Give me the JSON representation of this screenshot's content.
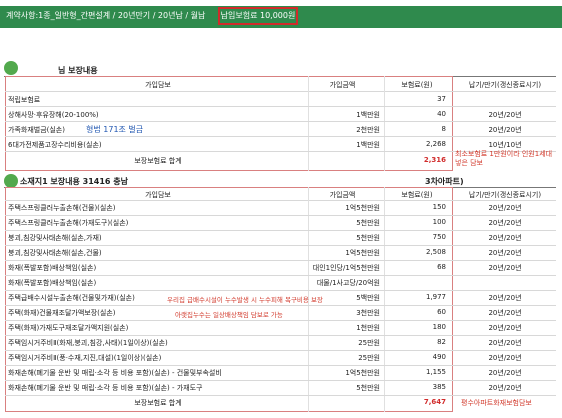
{
  "banner": {
    "text": "계약사항:1종_일반형_간편설계 / 20년만기 / 20년납 / 월납",
    "highlight": "납입보험료 10,000원"
  },
  "section1": {
    "title": "님 보장내용",
    "headers": [
      "가입담보",
      "가입금액",
      "보험료(원)",
      "납기/만기(갱신종료시기)"
    ],
    "rows": [
      {
        "name": "적립보험료",
        "amount": "",
        "premium": "37",
        "term": ""
      },
      {
        "name": "상해사망·후유장해(20-100%)",
        "amount": "1백만원",
        "premium": "40",
        "term": "20년/20년"
      },
      {
        "name": "가족화재벌금(실손)",
        "amount": "2천만원",
        "premium": "8",
        "term": "20년/20년"
      },
      {
        "name": "6대가전제품고장수리비용(실손)",
        "amount": "1백만원",
        "premium": "2,268",
        "term": "10년/10년"
      }
    ],
    "total_label": "보장보험료 합계",
    "total": "2,316",
    "note_blue": "형법 171조 벌금",
    "note_red": "최소보험료 1만원이라 인원1세대 넣은 담보"
  },
  "section2": {
    "title": "소재지1 보장내용 31416 충남",
    "subtitle": "3차아파트)",
    "headers": [
      "가입담보",
      "가입금액",
      "보험료(원)",
      "납기/만기(갱신종료시기)"
    ],
    "rows": [
      {
        "name": "주택스프링클러누출손해(건물)(실손)",
        "amount": "1억5천만원",
        "premium": "150",
        "term": "20년/20년"
      },
      {
        "name": "주택스프링클러누출손해(가재도구)(실손)",
        "amount": "5천만원",
        "premium": "100",
        "term": "20년/20년"
      },
      {
        "name": "붕괴,침강및사태손해(실손,가재)",
        "amount": "5천만원",
        "premium": "750",
        "term": "20년/20년"
      },
      {
        "name": "붕괴,침강및사태손해(실손,건물)",
        "amount": "1억5천만원",
        "premium": "2,508",
        "term": "20년/20년"
      },
      {
        "name": "화재(폭발포함)배상책임(실손)",
        "amount": "대인1인당/1억5천만원",
        "premium": "68",
        "term": "20년/20년"
      },
      {
        "name": "화재(폭발포함)배상책임(실손)",
        "amount": "대물/1사고당/20억원",
        "premium": "",
        "term": ""
      },
      {
        "name": "주택급배수시설누출손해(건물및가재)(실손)",
        "amount": "5백만원",
        "premium": "1,977",
        "term": "20년/20년"
      },
      {
        "name": "주택(화재)건물재조달가액보장(실손)",
        "amount": "3천만원",
        "premium": "60",
        "term": "20년/20년"
      },
      {
        "name": "주택(화재)가재도구재조달가액지원(실손)",
        "amount": "1천만원",
        "premium": "180",
        "term": "20년/20년"
      },
      {
        "name": "주택임시거주비Ⅱ(화재,붕괴,침강,사태)(1일이상)(실손)",
        "amount": "25만원",
        "premium": "82",
        "term": "20년/20년"
      },
      {
        "name": "주택임시거주비Ⅱ(풍·수재,지진,대설)(1일이상)(실손)",
        "amount": "25만원",
        "premium": "490",
        "term": "20년/20년"
      },
      {
        "name": "화재손해(폐기물 운반 및 매립·소각 등 비용 포함)(실손) - 건물및부속설비",
        "amount": "1억5천만원",
        "premium": "1,155",
        "term": "20년/20년"
      },
      {
        "name": "화재손해(폐기물 운반 및 매립·소각 등 비용 포함)(실손) - 가재도구",
        "amount": "5천만원",
        "premium": "385",
        "term": "20년/20년"
      }
    ],
    "total_label": "보장보험료 합계",
    "total": "7,647",
    "note1": "우리집 급배수시설이 누수발생 시 누수피해 복구비용 보장",
    "note2": "아랫집누수는 일상배상책임 담보로 가능",
    "note3": "평수아파트화재보험담보"
  },
  "colors": {
    "banner": "#2f8a4d",
    "accent_red": "#d12b2b",
    "note_red": "#d23a2c",
    "note_blue": "#2358b2"
  }
}
